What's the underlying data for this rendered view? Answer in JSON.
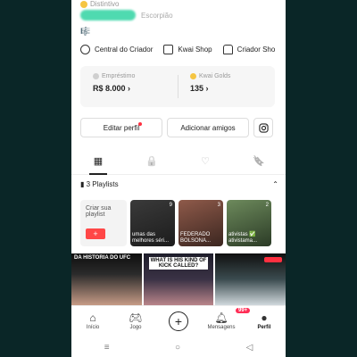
{
  "profile": {
    "top_line": "Distintivo",
    "location": "Escorpião",
    "small_icons": "🎼"
  },
  "shortcuts": [
    {
      "label": "Central do Criador",
      "icon": "plus-circle-icon"
    },
    {
      "label": "Kwai Shop",
      "icon": "shopping-bag-icon"
    },
    {
      "label": "Criador Sho",
      "icon": "shop-icon"
    }
  ],
  "wallet": {
    "loan_label": "Empréstimo",
    "loan_value": "R$ 8.000 ›",
    "golds_label": "Kwai Golds",
    "golds_value": "135 ›"
  },
  "actions": {
    "edit": "Editar perfil",
    "add": "Adicionar amigos",
    "instagram_icon": "instagram-icon"
  },
  "tabs": [
    {
      "icon": "▦",
      "name": "grid"
    },
    {
      "icon": "🔒",
      "name": "private"
    },
    {
      "icon": "♡",
      "name": "likes"
    },
    {
      "icon": "🔖",
      "name": "saved"
    }
  ],
  "playlists": {
    "title": "3 Playlists",
    "collapse_icon": "⌃",
    "create_label": "Criar sua playlist",
    "create_button": "+",
    "cards": [
      {
        "caption": "umas das melhores séri...",
        "count": "9"
      },
      {
        "caption": "FEDERADO BOLSONA...",
        "count": "3"
      },
      {
        "caption": "ativistas ✅ ativistama...",
        "count": "2"
      }
    ]
  },
  "videos": [
    {
      "title": "DA HISTORIA DO UFC"
    },
    {
      "title": "WHAT IS HIS KIND OF KICK CALLED?"
    },
    {
      "title": ""
    }
  ],
  "bottom_nav": {
    "home": "Início",
    "games": "Jogo",
    "create": "+",
    "messages": "Mensagens",
    "messages_badge": "99+",
    "profile": "Perfil"
  },
  "system_nav": {
    "recents": "≡",
    "home": "○",
    "back": "◁"
  }
}
